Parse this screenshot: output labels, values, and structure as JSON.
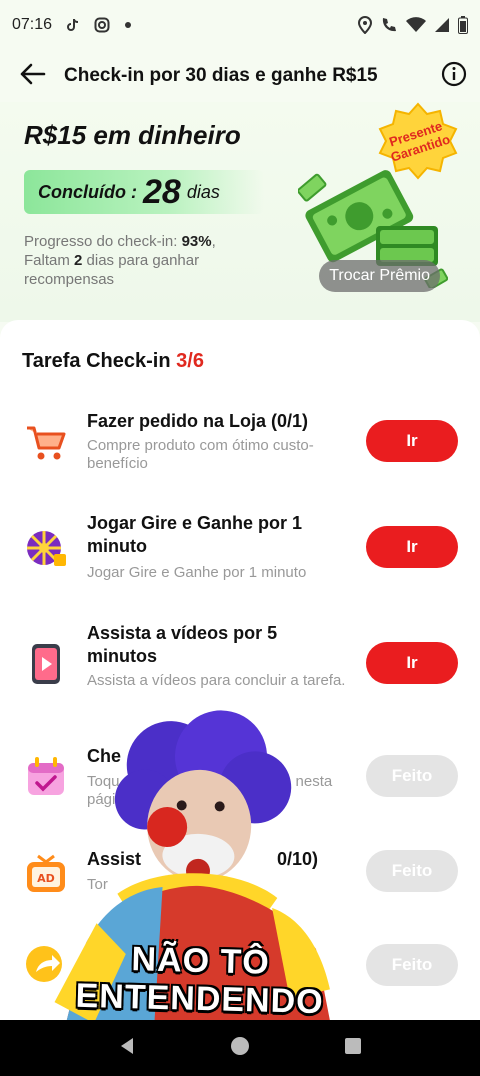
{
  "status_bar": {
    "time": "07:16",
    "icons": [
      "tiktok-icon",
      "instagram-icon",
      "dot-icon",
      "location-icon",
      "call-icon",
      "wifi-icon",
      "signal-icon",
      "battery-icon"
    ]
  },
  "header": {
    "title": "Check-in por 30 dias e ganhe R$15",
    "back_icon": "back-arrow-icon",
    "info_icon": "info-icon"
  },
  "hero": {
    "reward_title": "R$15 em dinheiro",
    "done_label": "Concluído :",
    "done_days": "28",
    "done_unit": "dias",
    "progress_label": "Progresso do check-in:",
    "progress_value": "93%",
    "progress_value_num": 0.93,
    "remaining_prefix": "Faltam",
    "remaining_days": "2",
    "remaining_suffix": "dias para ganhar recompensas",
    "badge_line1": "Presente",
    "badge_line2": "Garantido",
    "swap_prize_label": "Trocar Prêmio"
  },
  "tasks": {
    "header_label": "Tarefa Check-in",
    "count": "3/6",
    "items": [
      {
        "title": "Fazer pedido na Loja  (0/1)",
        "desc": "Compre produto com ótimo custo-benefício",
        "button": "Ir",
        "icon": "shopping-cart-icon",
        "state": "go"
      },
      {
        "title": "Jogar Gire e Ganhe por 1 minuto",
        "desc": "Jogar Gire e Ganhe por 1 minuto",
        "button": "Ir",
        "icon": "prize-wheel-icon",
        "state": "go"
      },
      {
        "title": "Assista a vídeos por 5 minutos",
        "desc": "Assista a vídeos para concluir a tarefa.",
        "button": "Ir",
        "icon": "video-phone-icon",
        "state": "go"
      },
      {
        "title": "Che",
        "desc_line1": "Toqu",
        "desc_line1_tail": "n nesta",
        "desc_line2": "págin",
        "button": "Feito",
        "icon": "calendar-check-icon",
        "state": "done"
      },
      {
        "title": "Assist",
        "title_tail": "0/10)",
        "desc": "Tor",
        "button": "Feito",
        "icon": "ad-tv-icon",
        "state": "done"
      },
      {
        "title": "",
        "desc": "",
        "button": "Feito",
        "icon": "share-arrow-icon",
        "state": "done"
      }
    ]
  },
  "sticker": {
    "caption_line1": "NÃO TÔ",
    "caption_line2": "ENTENDENDO"
  },
  "nav_bar": {
    "icons": [
      "nav-back-icon",
      "nav-home-icon",
      "nav-recents-icon"
    ]
  },
  "colors": {
    "accent_red": "#ea1d1f",
    "done_grey": "#e4e4e4",
    "pill_green": "#8ce69a"
  }
}
